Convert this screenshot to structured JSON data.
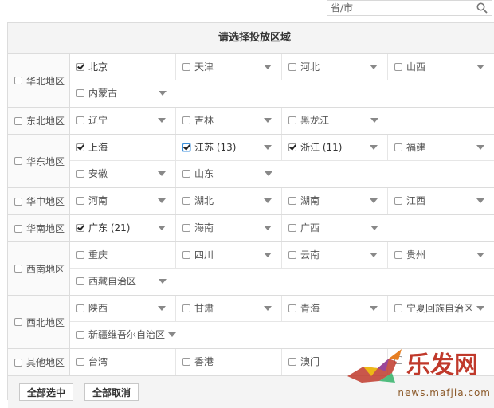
{
  "search": {
    "placeholder": "省/市"
  },
  "panel": {
    "title": "请选择投放区域"
  },
  "regions": [
    {
      "label": "华北地区",
      "rows": [
        [
          {
            "name": "北京",
            "checked": true,
            "arrow": false
          },
          {
            "name": "天津",
            "checked": false,
            "arrow": true
          },
          {
            "name": "河北",
            "checked": false,
            "arrow": true
          },
          {
            "name": "山西",
            "checked": false,
            "arrow": true
          }
        ],
        [
          {
            "name": "内蒙古",
            "checked": false,
            "arrow": true
          }
        ]
      ]
    },
    {
      "label": "东北地区",
      "rows": [
        [
          {
            "name": "辽宁",
            "checked": false,
            "arrow": true
          },
          {
            "name": "吉林",
            "checked": false,
            "arrow": true
          },
          {
            "name": "黑龙江",
            "checked": false,
            "arrow": true
          }
        ]
      ]
    },
    {
      "label": "华东地区",
      "rows": [
        [
          {
            "name": "上海",
            "checked": true,
            "arrow": false
          },
          {
            "name": "江苏 (13)",
            "checked": true,
            "focus": true,
            "arrow": true
          },
          {
            "name": "浙江 (11)",
            "checked": true,
            "arrow": true
          },
          {
            "name": "福建",
            "checked": false,
            "arrow": true
          }
        ],
        [
          {
            "name": "安徽",
            "checked": false,
            "arrow": true
          },
          {
            "name": "山东",
            "checked": false,
            "arrow": true
          }
        ]
      ]
    },
    {
      "label": "华中地区",
      "rows": [
        [
          {
            "name": "河南",
            "checked": false,
            "arrow": true
          },
          {
            "name": "湖北",
            "checked": false,
            "arrow": true
          },
          {
            "name": "湖南",
            "checked": false,
            "arrow": true
          },
          {
            "name": "江西",
            "checked": false,
            "arrow": true
          }
        ]
      ]
    },
    {
      "label": "华南地区",
      "rows": [
        [
          {
            "name": "广东 (21)",
            "checked": true,
            "arrow": true
          },
          {
            "name": "海南",
            "checked": false,
            "arrow": true
          },
          {
            "name": "广西",
            "checked": false,
            "arrow": true
          }
        ]
      ]
    },
    {
      "label": "西南地区",
      "rows": [
        [
          {
            "name": "重庆",
            "checked": false,
            "arrow": false
          },
          {
            "name": "四川",
            "checked": false,
            "arrow": true
          },
          {
            "name": "云南",
            "checked": false,
            "arrow": true
          },
          {
            "name": "贵州",
            "checked": false,
            "arrow": true
          }
        ],
        [
          {
            "name": "西藏自治区",
            "checked": false,
            "arrow": true
          }
        ]
      ]
    },
    {
      "label": "西北地区",
      "rows": [
        [
          {
            "name": "陕西",
            "checked": false,
            "arrow": true
          },
          {
            "name": "甘肃",
            "checked": false,
            "arrow": true
          },
          {
            "name": "青海",
            "checked": false,
            "arrow": true
          },
          {
            "name": "宁夏回族自治区",
            "checked": false,
            "arrow": true
          }
        ],
        [
          {
            "name": "新疆维吾尔自治区",
            "checked": false,
            "arrow": true,
            "wide": true
          }
        ]
      ]
    },
    {
      "label": "其他地区",
      "rows": [
        [
          {
            "name": "台湾",
            "checked": false,
            "arrow": false
          },
          {
            "name": "香港",
            "checked": false,
            "arrow": false
          },
          {
            "name": "澳门",
            "checked": false,
            "arrow": false
          },
          {
            "name": "",
            "checked": false,
            "arrow": false
          }
        ]
      ]
    }
  ],
  "footer": {
    "select_all": "全部选中",
    "deselect_all": "全部取消"
  },
  "watermark": {
    "text": "news.mafjia.com"
  },
  "colors": {
    "border": "#dcdcdc",
    "header_bg": "#f4f4f4",
    "text": "#333333",
    "focus": "#3b8fd8"
  }
}
